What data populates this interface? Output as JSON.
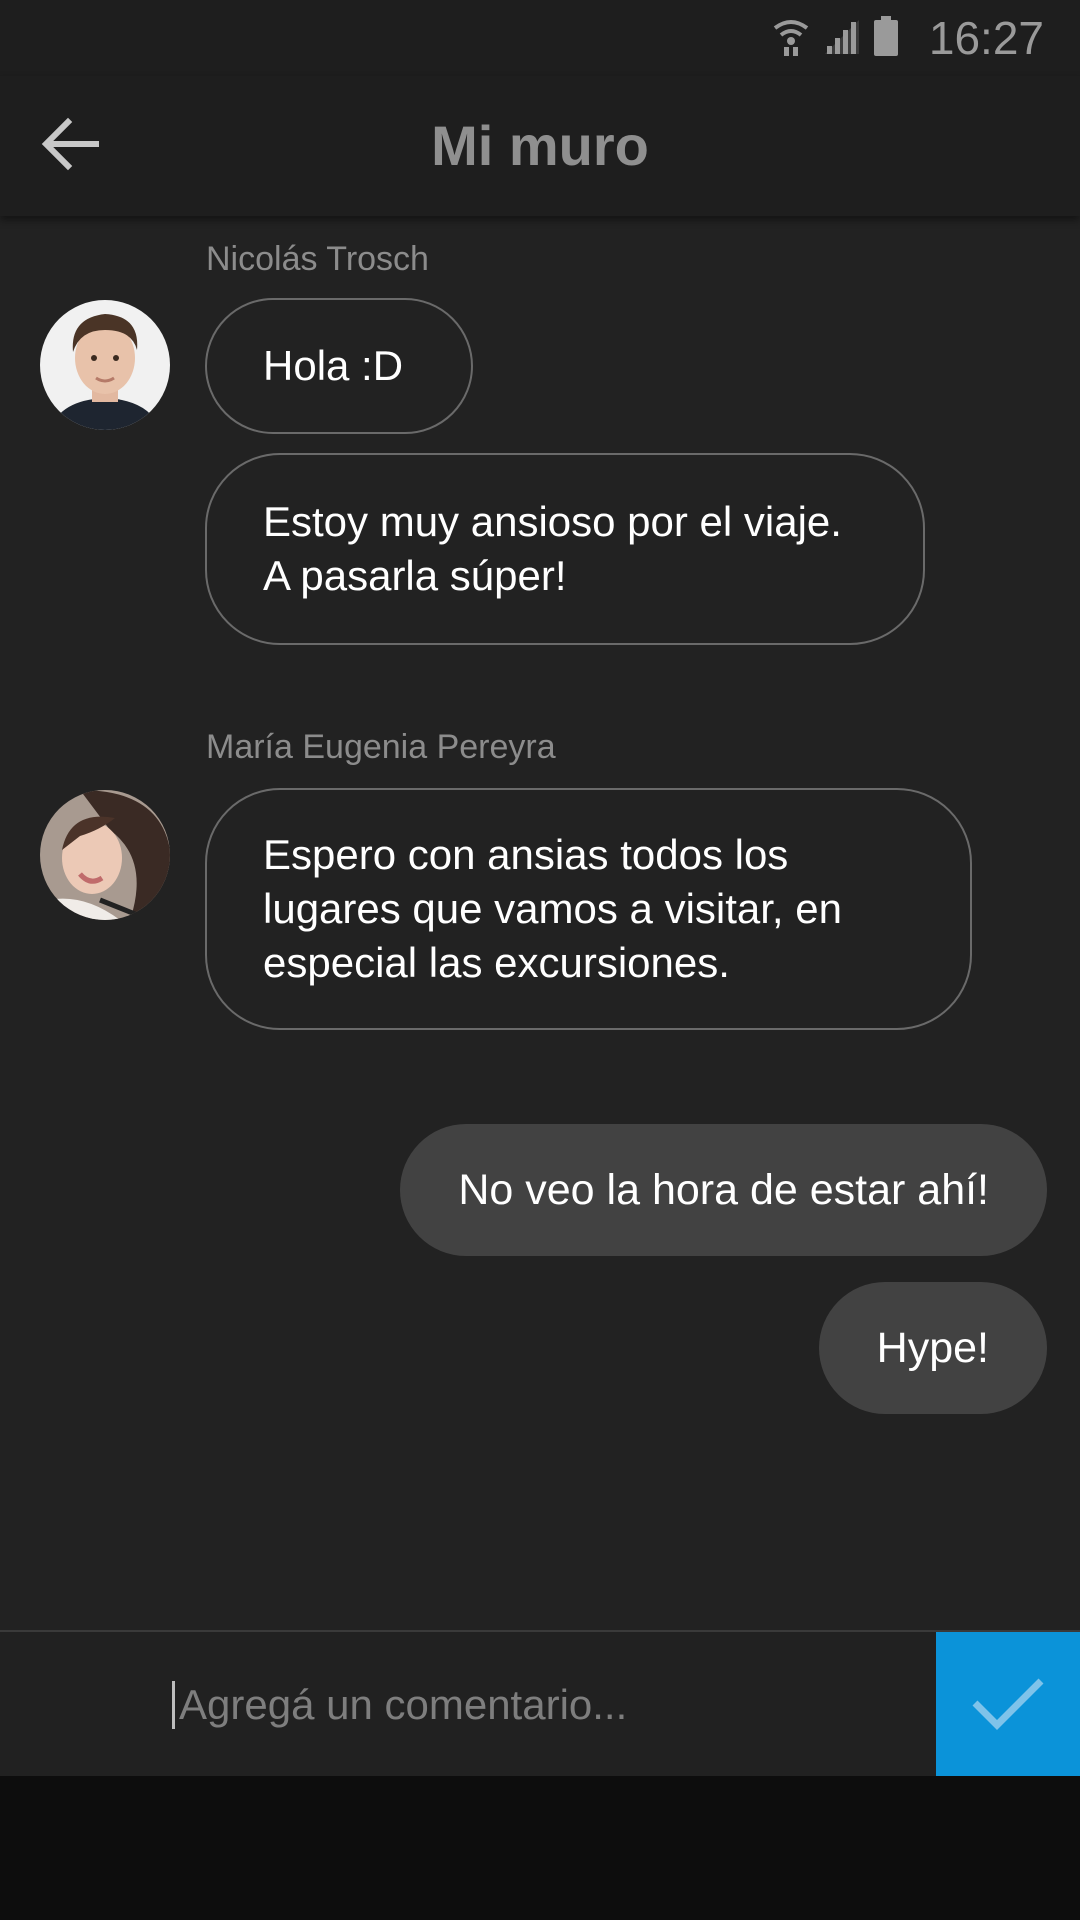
{
  "status_bar": {
    "time": "16:27",
    "icons": [
      "wifi-icon",
      "signal-icon",
      "battery-icon"
    ]
  },
  "header": {
    "title": "Mi muro",
    "back_icon": "arrow-left-icon"
  },
  "messages": [
    {
      "sender": "Nicolás Trosch",
      "bubbles": [
        "Hola :D",
        "Estoy muy ansioso por el viaje.\nA pasarla súper!"
      ]
    },
    {
      "sender": "María Eugenia Pereyra",
      "bubbles": [
        "Espero con ansias todos los\nlugares que vamos a visitar, en\nespecial las excursiones."
      ]
    }
  ],
  "own_messages": [
    "No veo la hora de estar ahí!",
    "Hype!"
  ],
  "comment_bar": {
    "placeholder": "Agregá un comentario...",
    "send_icon": "check-icon"
  },
  "colors": {
    "background": "#222222",
    "header": "#1e1e1e",
    "accent": "#0b93d9",
    "own_bubble": "#424242"
  }
}
